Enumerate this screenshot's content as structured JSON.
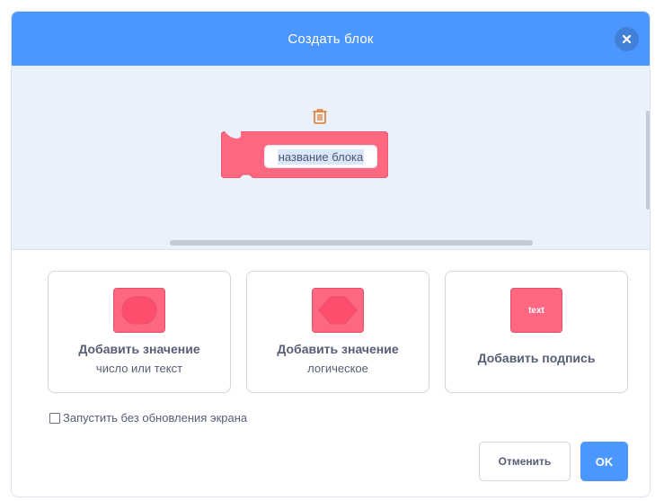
{
  "dialog": {
    "title": "Создать блок",
    "close_icon": "close-icon",
    "header_color": "#4c97ff"
  },
  "workspace": {
    "trash_icon": "trash-icon",
    "block_name_value": "название блока",
    "block_color": "#ff6680"
  },
  "options": [
    {
      "title": "Добавить значение",
      "subtitle": "число или текст",
      "icon": "round-input-icon"
    },
    {
      "title": "Добавить значение",
      "subtitle": "логическое",
      "icon": "boolean-input-icon"
    },
    {
      "title": "Добавить подпись",
      "subtitle": "",
      "icon": "label-text-icon",
      "chip_text": "text"
    }
  ],
  "run_without_refresh": {
    "label": "Запустить без обновления экрана",
    "checked": false
  },
  "buttons": {
    "cancel": "Отменить",
    "ok": "OK"
  },
  "colors": {
    "accent": "#4c97ff",
    "block": "#ff6680",
    "text": "#575e75"
  }
}
